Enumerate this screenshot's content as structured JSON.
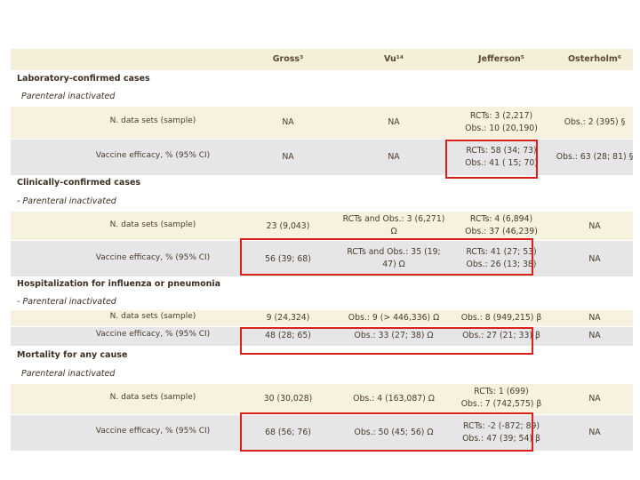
{
  "header": {
    "gross": "Gross³",
    "vu": "Vu¹⁴",
    "jefferson": "Jefferson⁵",
    "osterholm": "Osterholm⁶"
  },
  "sections": [
    {
      "title": "Laboratory-confirmed cases",
      "subtitle": "Parenteral inactivated",
      "rows": [
        {
          "label": "N. data sets (sample)",
          "gross": "NA",
          "vu": "NA",
          "jefferson": [
            "RCTs: 3 (2,217)",
            "Obs.: 10 (20,190)"
          ],
          "osterholm": "Obs.: 2 (395) §"
        },
        {
          "label": "Vaccine efficacy, % (95% CI)",
          "gross": "NA",
          "vu": "NA",
          "jefferson": [
            "RCTs: 58 (34; 73)",
            "Obs.: 41 ( 15; 70)"
          ],
          "osterholm": "Obs.: 63 (28; 81) §"
        }
      ]
    },
    {
      "title": "Clinically-confirmed cases",
      "subtitle": "- Parenteral inactivated",
      "rows": [
        {
          "label": "N. data sets (sample)",
          "gross": "23 (9,043)",
          "vu": [
            "RCTs and Obs.: 3 (6,271)",
            "Ω"
          ],
          "jefferson": [
            "RCTs: 4 (6,894)",
            "Obs.: 37 (46,239)"
          ],
          "osterholm": "NA"
        },
        {
          "label": "Vaccine efficacy, % (95% CI)",
          "gross": "56 (39; 68)",
          "vu": [
            "RCTs and Obs.: 35 (19;",
            "47) Ω"
          ],
          "jefferson": [
            "RCTs: 41 (27; 53)",
            "Obs.: 26 (13; 38)"
          ],
          "osterholm": "NA"
        }
      ]
    },
    {
      "title": "Hospitalization for influenza or pneumonia",
      "subtitle": "- Parenteral inactivated",
      "rows": [
        {
          "label": "N. data sets (sample)",
          "gross": "9 (24,324)",
          "vu": "Obs.: 9 (> 446,336) Ω",
          "jefferson": "Obs.: 8 (949,215) β",
          "osterholm": "NA"
        },
        {
          "label": "Vaccine efficacy, % (95% CI)",
          "gross": "48 (28; 65)",
          "vu": "Obs.: 33 (27; 38) Ω",
          "jefferson": "Obs.: 27 (21; 33) β",
          "osterholm": "NA"
        }
      ]
    },
    {
      "title": "Mortality for any cause",
      "subtitle": "Parenteral inactivated",
      "rows": [
        {
          "label": "N. data sets (sample)",
          "gross": "30 (30,028)",
          "vu": "Obs.: 4 (163,087) Ω",
          "jefferson": [
            "RCTs: 1 (699)",
            "Obs.: 7 (742,575) β"
          ],
          "osterholm": "NA"
        },
        {
          "label": "Vaccine efficacy, % (95% CI)",
          "gross": "68 (56; 76)",
          "vu": "Obs.: 50 (45; 56) Ω",
          "jefferson": [
            "RCTs: -2 (-872; 89)",
            "Obs.: 47 (39; 54) β"
          ],
          "osterholm": "NA"
        }
      ]
    }
  ],
  "highlight_color": "#d9201c"
}
